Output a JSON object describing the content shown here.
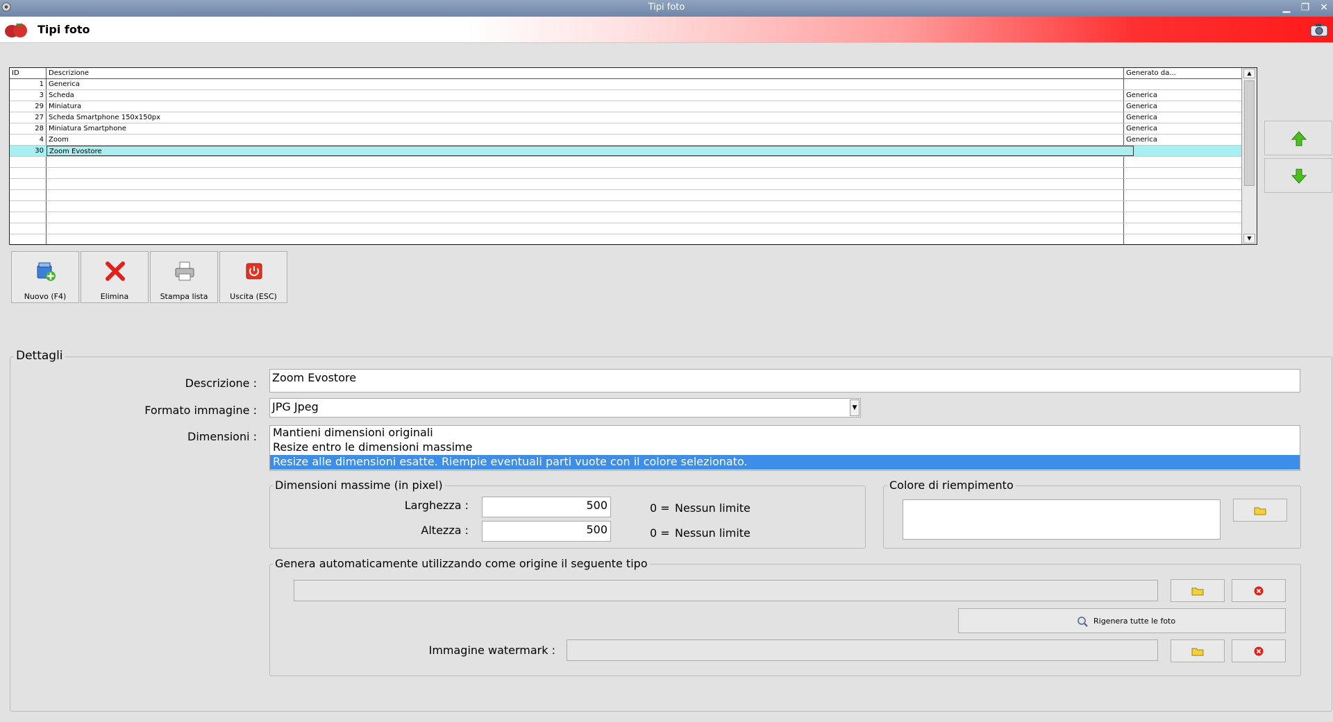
{
  "window": {
    "title": "Tipi foto"
  },
  "header": {
    "title": "Tipi foto"
  },
  "grid": {
    "columns": [
      "ID",
      "Descrizione",
      "Generato da..."
    ],
    "rows": [
      {
        "id": "1",
        "desc": "Generica",
        "gen": ""
      },
      {
        "id": "3",
        "desc": "Scheda",
        "gen": "Generica"
      },
      {
        "id": "29",
        "desc": "Miniatura",
        "gen": "Generica"
      },
      {
        "id": "27",
        "desc": "Scheda Smartphone 150x150px",
        "gen": "Generica"
      },
      {
        "id": "28",
        "desc": "Miniatura Smartphone",
        "gen": "Generica"
      },
      {
        "id": "4",
        "desc": "Zoom",
        "gen": "Generica"
      },
      {
        "id": "30",
        "desc": "Zoom Evostore",
        "gen": ""
      }
    ],
    "selected_row": 6,
    "empty_rows": 8
  },
  "toolbar": {
    "new_label": "Nuovo (F4)",
    "delete_label": "Elimina",
    "print_label": "Stampa lista",
    "exit_label": "Uscita (ESC)"
  },
  "details": {
    "legend": "Dettagli",
    "descrizione_label": "Descrizione :",
    "descrizione_value": "Zoom Evostore",
    "formato_label": "Formato immagine :",
    "formato_value": "JPG Jpeg",
    "dimensioni_label": "Dimensioni :",
    "dimensioni_options": [
      "Mantieni dimensioni originali",
      "Resize entro le dimensioni massime",
      "Resize alle dimensioni esatte. Riempie eventuali parti vuote con il colore selezionato."
    ],
    "dimensioni_selected": 2,
    "max_dim": {
      "legend": "Dimensioni massime (in pixel)",
      "larghezza_label": "Larghezza :",
      "larghezza_value": "500",
      "altezza_label": "Altezza :",
      "altezza_value": "500",
      "zero_label": "0 =",
      "no_limit_label": "Nessun limite"
    },
    "fill_color": {
      "legend": "Colore di riempimento",
      "value": ""
    },
    "auto_gen": {
      "legend": "Genera automaticamente utilizzando come origine il seguente tipo",
      "source_value": "",
      "regen_label": "Rigenera tutte le foto",
      "watermark_label": "Immagine watermark :",
      "watermark_value": ""
    }
  },
  "colors": {
    "selection_row": "#a9eef0",
    "list_selection": "#3d8ee8",
    "arrow_green": "#4bbf1e",
    "delete_red": "#e0231a"
  }
}
